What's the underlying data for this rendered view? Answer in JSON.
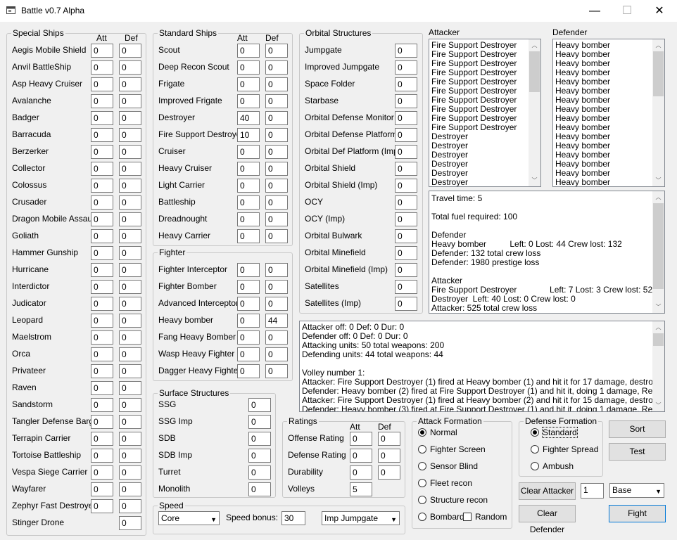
{
  "window": {
    "title": "Battle v0.7 Alpha",
    "min": "—",
    "max": "☐",
    "close": "✕"
  },
  "special": {
    "legend": "Special Ships",
    "att": "Att",
    "def": "Def",
    "rows": [
      [
        "Aegis Mobile Shield",
        "0",
        "0"
      ],
      [
        "Anvil BattleShip",
        "0",
        "0"
      ],
      [
        "Asp Heavy Cruiser",
        "0",
        "0"
      ],
      [
        "Avalanche",
        "0",
        "0"
      ],
      [
        "Badger",
        "0",
        "0"
      ],
      [
        "Barracuda",
        "0",
        "0"
      ],
      [
        "Berzerker",
        "0",
        "0"
      ],
      [
        "Collector",
        "0",
        "0"
      ],
      [
        "Colossus",
        "0",
        "0"
      ],
      [
        "Crusader",
        "0",
        "0"
      ],
      [
        "Dragon Mobile Assault",
        "0",
        "0"
      ],
      [
        "Goliath",
        "0",
        "0"
      ],
      [
        "Hammer Gunship",
        "0",
        "0"
      ],
      [
        "Hurricane",
        "0",
        "0"
      ],
      [
        "Interdictor",
        "0",
        "0"
      ],
      [
        "Judicator",
        "0",
        "0"
      ],
      [
        "Leopard",
        "0",
        "0"
      ],
      [
        "Maelstrom",
        "0",
        "0"
      ],
      [
        "Orca",
        "0",
        "0"
      ],
      [
        "Privateer",
        "0",
        "0"
      ],
      [
        "Raven",
        "0",
        "0"
      ],
      [
        "Sandstorm",
        "0",
        "0"
      ],
      [
        "Tangler Defense Barge",
        "0",
        "0"
      ],
      [
        "Terrapin Carrier",
        "0",
        "0"
      ],
      [
        "Tortoise Battleship",
        "0",
        "0"
      ],
      [
        "Vespa Siege Carrier",
        "0",
        "0"
      ],
      [
        "Wayfarer",
        "0",
        "0"
      ],
      [
        "Zephyr Fast Destroyer",
        "0",
        "0"
      ],
      [
        "Stinger Drone",
        "",
        "0"
      ]
    ]
  },
  "standard": {
    "legend": "Standard Ships",
    "att": "Att",
    "def": "Def",
    "rows": [
      [
        "Scout",
        "0",
        "0"
      ],
      [
        "Deep Recon Scout",
        "0",
        "0"
      ],
      [
        "Frigate",
        "0",
        "0"
      ],
      [
        "Improved Frigate",
        "0",
        "0"
      ],
      [
        "Destroyer",
        "40",
        "0"
      ],
      [
        "Fire Support Destroyer",
        "10",
        "0"
      ],
      [
        "Cruiser",
        "0",
        "0"
      ],
      [
        "Heavy Cruiser",
        "0",
        "0"
      ],
      [
        "Light Carrier",
        "0",
        "0"
      ],
      [
        "Battleship",
        "0",
        "0"
      ],
      [
        "Dreadnought",
        "0",
        "0"
      ],
      [
        "Heavy Carrier",
        "0",
        "0"
      ]
    ]
  },
  "fighter": {
    "legend": "Fighter",
    "rows": [
      [
        "Fighter Interceptor",
        "0",
        "0"
      ],
      [
        "Fighter Bomber",
        "0",
        "0"
      ],
      [
        "Advanced Interceptor",
        "0",
        "0"
      ],
      [
        "Heavy bomber",
        "0",
        "44"
      ],
      [
        "Fang Heavy Bomber",
        "0",
        "0"
      ],
      [
        "Wasp Heavy Fighter",
        "0",
        "0"
      ],
      [
        "Dagger Heavy Fighter",
        "0",
        "0"
      ]
    ]
  },
  "surface": {
    "legend": "Surface Structures",
    "rows": [
      [
        "SSG",
        "0"
      ],
      [
        "SSG Imp",
        "0"
      ],
      [
        "SDB",
        "0"
      ],
      [
        "SDB Imp",
        "0"
      ],
      [
        "Turret",
        "0"
      ],
      [
        "Monolith",
        "0"
      ]
    ]
  },
  "orbital": {
    "legend": "Orbital Structures",
    "rows": [
      [
        "Jumpgate",
        "0"
      ],
      [
        "Improved Jumpgate",
        "0"
      ],
      [
        "Space Folder",
        "0"
      ],
      [
        "Starbase",
        "0"
      ],
      [
        "Orbital Defense Monitor",
        "0"
      ],
      [
        "Orbital Defense Platform",
        "0"
      ],
      [
        "Orbital Def Platform (Imp)",
        "0"
      ],
      [
        "Orbital Shield",
        "0"
      ],
      [
        "Orbital Shield (Imp)",
        "0"
      ],
      [
        "OCY",
        "0"
      ],
      [
        "OCY (Imp)",
        "0"
      ],
      [
        "Orbital Bulwark",
        "0"
      ],
      [
        "Orbital Minefield",
        "0"
      ],
      [
        "Orbital Minefield (Imp)",
        "0"
      ],
      [
        "Satellites",
        "0"
      ],
      [
        "Satellites (Imp)",
        "0"
      ]
    ]
  },
  "speed": {
    "legend": "Speed",
    "combo1": "Core",
    "bonus_label": "Speed bonus:",
    "bonus": "30",
    "combo2": "Imp Jumpgate"
  },
  "ratings": {
    "legend": "Ratings",
    "att": "Att",
    "def": "Def",
    "rows": [
      [
        "Offense Rating",
        "0",
        "0"
      ],
      [
        "Defense Rating",
        "0",
        "0"
      ],
      [
        "Durability",
        "0",
        "0"
      ],
      [
        "Volleys",
        "5",
        ""
      ]
    ]
  },
  "attack_formation": {
    "legend": "Attack Formation",
    "options": [
      "Normal",
      "Fighter Screen",
      "Sensor Blind",
      "Fleet recon",
      "Structure recon",
      "Bombard"
    ],
    "selected": 0,
    "random": "Random"
  },
  "defense_formation": {
    "legend": "Defense Formation",
    "options": [
      "Standard",
      "Fighter Spread",
      "Ambush"
    ],
    "selected": 0
  },
  "attacker": {
    "label": "Attacker",
    "items": [
      "Fire Support Destroyer",
      "Fire Support Destroyer",
      "Fire Support Destroyer",
      "Fire Support Destroyer",
      "Fire Support Destroyer",
      "Fire Support Destroyer",
      "Fire Support Destroyer",
      "Fire Support Destroyer",
      "Fire Support Destroyer",
      "Fire Support Destroyer",
      "Destroyer",
      "Destroyer",
      "Destroyer",
      "Destroyer",
      "Destroyer",
      "Destroyer"
    ]
  },
  "defender": {
    "label": "Defender",
    "items": [
      "Heavy bomber",
      "Heavy bomber",
      "Heavy bomber",
      "Heavy bomber",
      "Heavy bomber",
      "Heavy bomber",
      "Heavy bomber",
      "Heavy bomber",
      "Heavy bomber",
      "Heavy bomber",
      "Heavy bomber",
      "Heavy bomber",
      "Heavy bomber",
      "Heavy bomber",
      "Heavy bomber",
      "Heavy bomber"
    ]
  },
  "summary": [
    "Travel time: 5",
    "",
    "Total fuel required: 100",
    "",
    "Defender",
    "Heavy bomber          Left: 0 Lost: 44 Crew lost: 132",
    "Defender: 132 total crew loss",
    "Defender: 1980 prestige loss",
    "",
    "Attacker",
    "Fire Support Destroyer              Left: 7 Lost: 3 Crew lost: 525",
    "Destroyer  Left: 40 Lost: 0 Crew lost: 0",
    "Attacker: 525 total crew loss"
  ],
  "log": [
    "Attacker off: 0 Def: 0 Dur: 0",
    "Defender off: 0 Def: 0 Dur: 0",
    "Attacking units: 50 total weapons: 200",
    "Defending units: 44 total weapons: 44",
    "",
    "Volley number 1:",
    "Attacker: Fire Support Destroyer (1) fired at Heavy bomber (1) and hit it for 17 damage, destroying it!",
    "Defender: Heavy bomber (2) fired at Fire Support Destroyer (1) and hit it, doing 1 damage, Remaining hull s",
    "Attacker: Fire Support Destroyer (1) fired at Heavy bomber (2) and hit it for 15 damage, destroying it!",
    "Defender: Heavy bomber (3) fired at Fire Support Destroyer (1) and hit it, doing 1 damage, Remaining hull s"
  ],
  "buttons": {
    "sort": "Sort",
    "test": "Test",
    "clear_attacker": "Clear Attacker",
    "clear_defender": "Clear Defender",
    "fight": "Fight",
    "count": "1",
    "base": "Base"
  }
}
